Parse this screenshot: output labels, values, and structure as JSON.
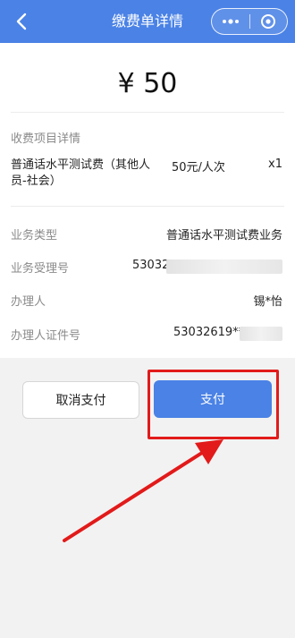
{
  "nav": {
    "title": "缴费单详情",
    "back_icon": "chevron-left-icon",
    "more_icon": "more-dots-icon",
    "close_icon": "target-icon"
  },
  "summary": {
    "amount": "¥ 50"
  },
  "fee_details": {
    "section_title": "收费项目详情",
    "item_name": "普通话水平测试费（其他人员-社会）",
    "unit_price": "50元/人次",
    "quantity": "x1"
  },
  "business_info": {
    "type_label": "业务类型",
    "type_value": "普通话水平测试费业务",
    "number_label": "业务受理号",
    "number_value": "53032",
    "handler_label": "办理人",
    "handler_value": "锡*怡",
    "id_label": "办理人证件号",
    "id_value": "53032619**"
  },
  "actions": {
    "cancel_label": "取消支付",
    "pay_label": "支付"
  },
  "colors": {
    "brand_blue": "#4a82e6",
    "annotation_red": "#e21a1a"
  }
}
